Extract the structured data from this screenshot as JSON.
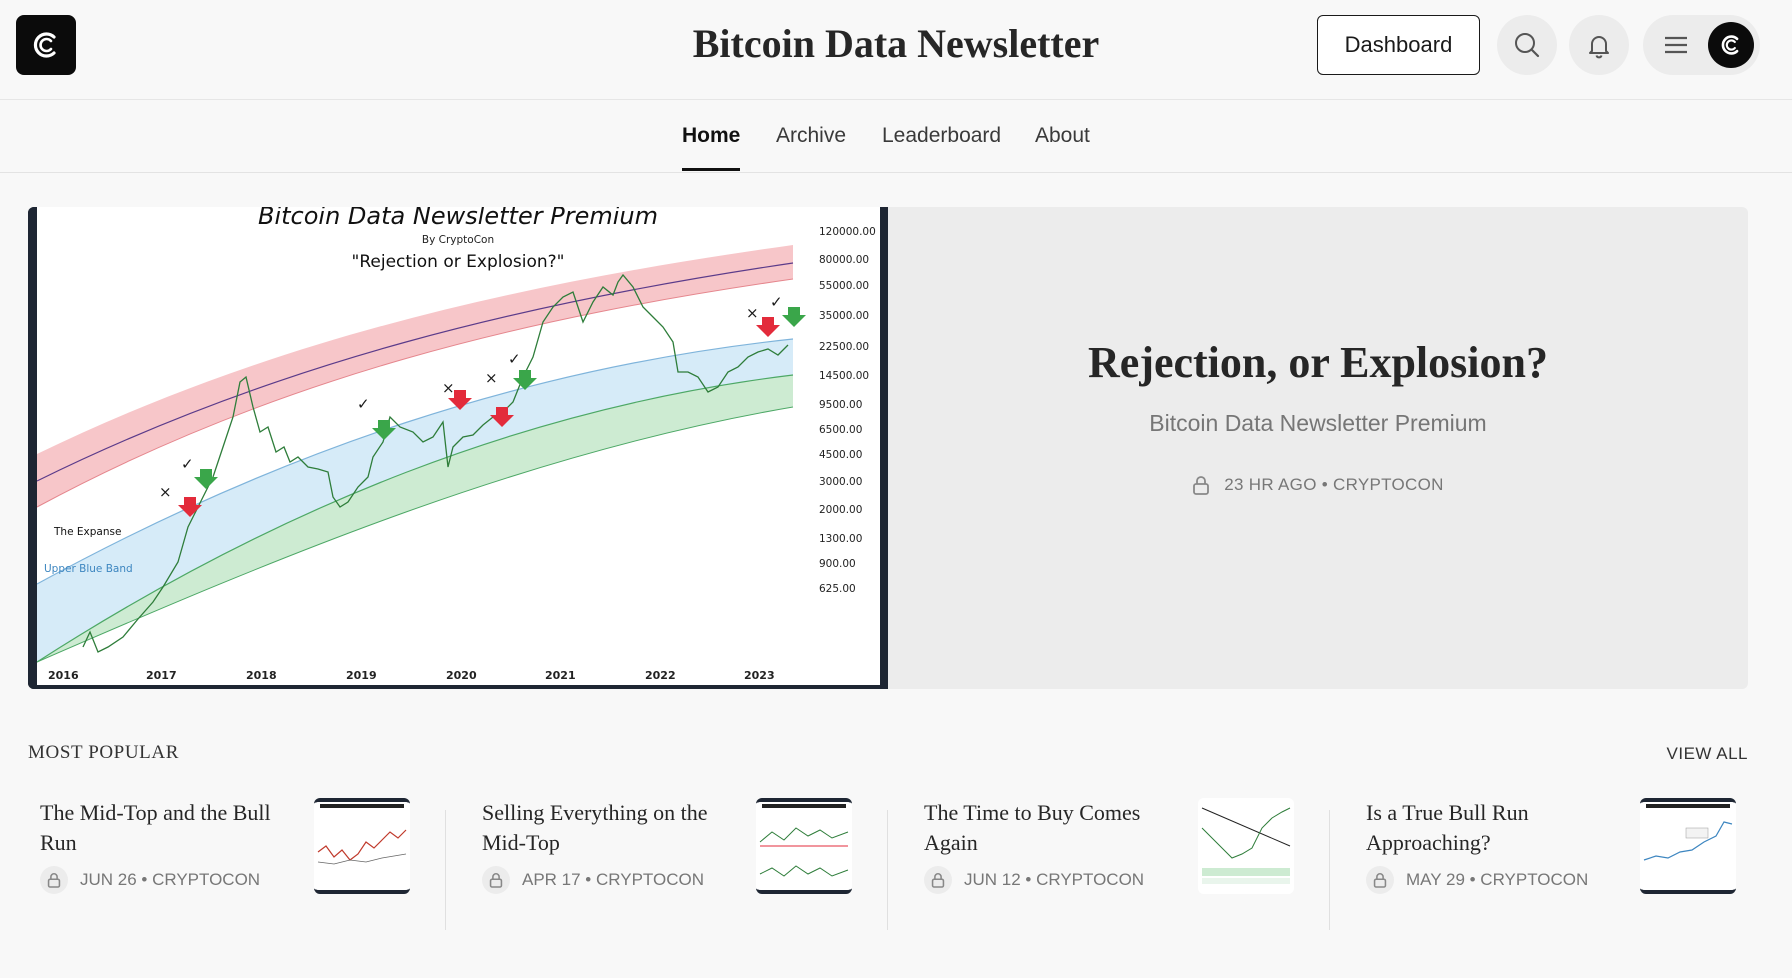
{
  "header": {
    "site_title": "Bitcoin Data Newsletter",
    "dashboard_label": "Dashboard",
    "icons": [
      "logo-icon",
      "search-icon",
      "bell-icon",
      "menu-icon",
      "avatar-icon"
    ]
  },
  "nav": {
    "items": [
      {
        "label": "Home",
        "active": true
      },
      {
        "label": "Archive",
        "active": false
      },
      {
        "label": "Leaderboard",
        "active": false
      },
      {
        "label": "About",
        "active": false
      }
    ]
  },
  "hero": {
    "title": "Rejection, or Explosion?",
    "subtitle": "Bitcoin Data Newsletter Premium",
    "meta": "23 HR AGO • CRYPTOCON",
    "image": {
      "title": "Bitcoin Data Newsletter Premium",
      "byline": "By CryptoCon",
      "quote": "\"Rejection or Explosion?\"",
      "label_expanse": "The Expanse",
      "label_band": "Upper Blue Band",
      "y_ticks": [
        "120000.00",
        "80000.00",
        "55000.00",
        "35000.00",
        "22500.00",
        "14500.00",
        "9500.00",
        "6500.00",
        "4500.00",
        "3000.00",
        "2000.00",
        "1300.00",
        "900.00",
        "625.00"
      ],
      "x_ticks": [
        "2016",
        "2017",
        "2018",
        "2019",
        "2020",
        "2021",
        "2022",
        "2023"
      ]
    }
  },
  "popular": {
    "heading": "MOST POPULAR",
    "view_all": "VIEW ALL",
    "posts": [
      {
        "title": "The Mid-Top and the Bull Run",
        "meta": "JUN 26 • CRYPTOCON"
      },
      {
        "title": "Selling Everything on the Mid-Top",
        "meta": "APR 17 • CRYPTOCON"
      },
      {
        "title": "The Time to Buy Comes Again",
        "meta": "JUN 12 • CRYPTOCON"
      },
      {
        "title": "Is a True Bull Run Approaching?",
        "meta": "MAY 29 • CRYPTOCON"
      }
    ]
  },
  "colors": {
    "accent": "#1a1a1a",
    "chip_bg": "#ececec",
    "band_red": "#f7c6c9",
    "band_blue": "#d6ebf8",
    "band_green": "#cdebd2",
    "arrow_red": "#e32b3b",
    "arrow_green": "#3aa64a"
  }
}
